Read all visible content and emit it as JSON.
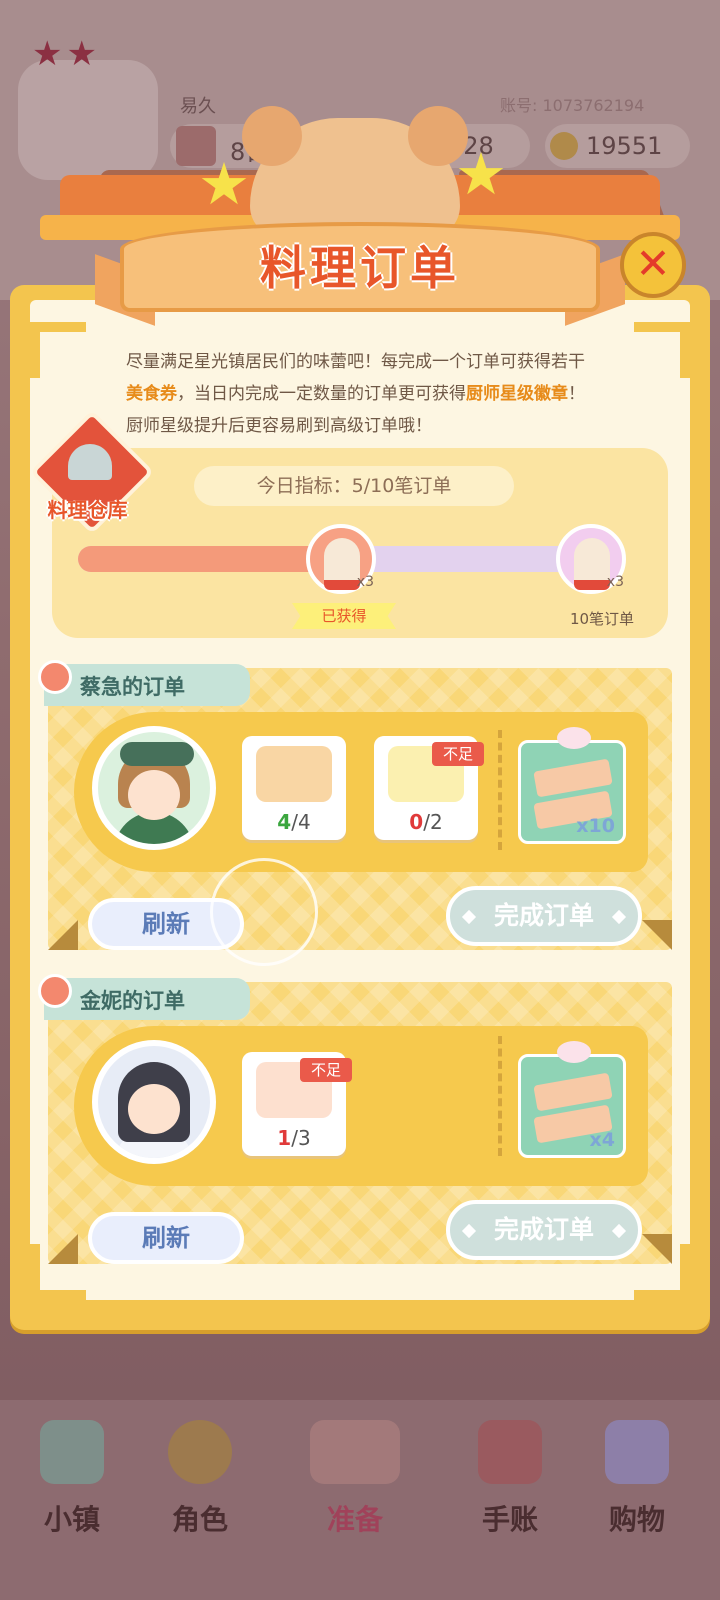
{
  "hud": {
    "username": "易久",
    "account_label": "账号: 1073762194",
    "date_value": "8日",
    "middle_value": "428",
    "coin_value": "19551"
  },
  "dialog": {
    "title": "料理订单",
    "close_symbol": "✕",
    "description_parts": [
      "尽量满足星光镇居民们的味蕾吧！每完成一个订单可获得若干",
      "美食券",
      "，当日内完成一定数量的订单更可获得",
      "厨师星级徽章",
      "！厨师星级提升后更容易刷到高级订单哦！"
    ],
    "warehouse_label": "料理仓库",
    "target_text": "今日指标：5/10笔订单",
    "progress_fraction": 0.5,
    "milestones": [
      {
        "qty": "x3",
        "status": "已获得"
      },
      {
        "qty": "x3",
        "label": "10笔订单"
      }
    ]
  },
  "orders": [
    {
      "title": "蔡急的订单",
      "items": [
        {
          "name": "dumpling-plate",
          "have": "4",
          "need": "/4",
          "lacking": false
        },
        {
          "name": "banana",
          "have": "0",
          "need": "/2",
          "lacking": true,
          "lack_label": "不足"
        }
      ],
      "reward_qty": "x10",
      "refresh_label": "刷新",
      "complete_label": "完成订单"
    },
    {
      "title": "金妮的订单",
      "items": [
        {
          "name": "shrimp-salad",
          "have": "1",
          "need": "/3",
          "lacking": true,
          "lack_label": "不足"
        }
      ],
      "reward_qty": "x4",
      "refresh_label": "刷新",
      "complete_label": "完成订单"
    }
  ],
  "nav": {
    "items": [
      "小镇",
      "角色",
      "准备",
      "手账",
      "购物"
    ]
  },
  "colors": {
    "accent_title": "#e8562a",
    "highlight": "#e78b1a",
    "have_ok": "#3ba63f",
    "have_lack": "#e03a3a"
  }
}
